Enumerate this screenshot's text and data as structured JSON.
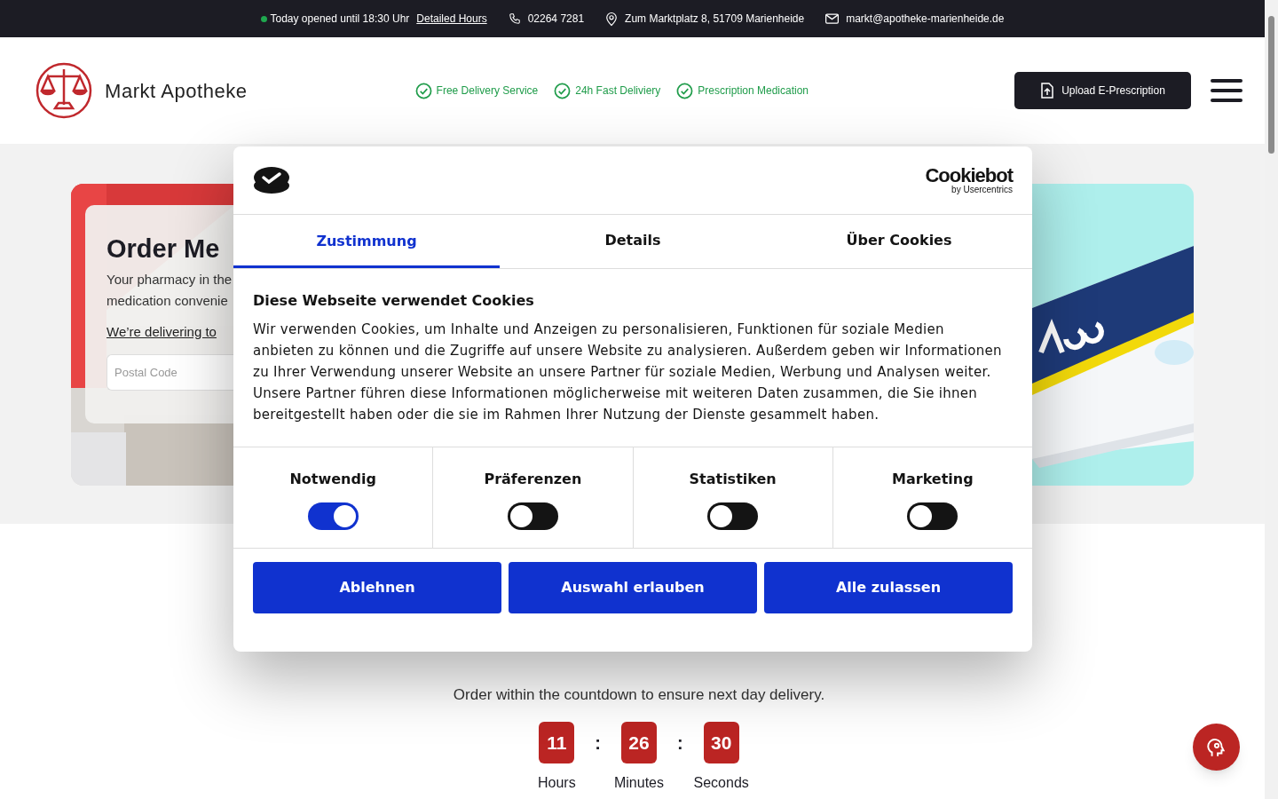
{
  "top_bar": {
    "open_status": {
      "text": "Today opened until 18:30 Uhr",
      "color": "#1fa84f"
    },
    "hours_link": "Detailed Hours",
    "phone": "02264 7281",
    "address": "Zum Marktplatz 8, 51709 Marienheide",
    "email": "markt@apotheke-marienheide.de"
  },
  "header": {
    "brand": "Markt Apotheke",
    "features": [
      "Free Delivery Service",
      "24h Fast Deliviery",
      "Prescription Medication"
    ],
    "upload_button": "Upload E-Prescription"
  },
  "hero": {
    "title": "Order Me",
    "text_lines": [
      "Your pharmacy in the",
      "medication convenie"
    ],
    "delivery_link": "We’re delivering to",
    "postal_placeholder": "Postal Code"
  },
  "consent": {
    "brand": "Cookiebot",
    "brand_sub": "by Usercentrics",
    "tabs": [
      {
        "label": "Zustimmung",
        "selected": true
      },
      {
        "label": "Details",
        "selected": false
      },
      {
        "label": "Über Cookies",
        "selected": false
      }
    ],
    "heading": "Diese Webseite verwendet Cookies",
    "body": "Wir verwenden Cookies, um Inhalte und Anzeigen zu personalisieren, Funktionen für soziale Medien anbieten zu können und die Zugriffe auf unsere Website zu analysieren. Außerdem geben wir Informationen zu Ihrer Verwendung unserer Website an unsere Partner für soziale Medien, Werbung und Analysen weiter. Unsere Partner führen diese Informationen möglicherweise mit weiteren Daten zusammen, die Sie ihnen bereitgestellt haben oder die sie im Rahmen Ihrer Nutzung der Dienste gesammelt haben.",
    "categories": [
      {
        "label": "Notwendig",
        "on": true
      },
      {
        "label": "Präferenzen",
        "on": false
      },
      {
        "label": "Statistiken",
        "on": false
      },
      {
        "label": "Marketing",
        "on": false
      }
    ],
    "buttons": [
      "Ablehnen",
      "Auswahl erlauben",
      "Alle zulassen"
    ]
  },
  "order": {
    "subtitle": "Order within the countdown to ensure next day delivery.",
    "countdown": [
      {
        "value": "11",
        "label": "Hours"
      },
      {
        "value": "26",
        "label": "Minutes"
      },
      {
        "value": "30",
        "label": "Seconds"
      }
    ],
    "separator": ":"
  }
}
